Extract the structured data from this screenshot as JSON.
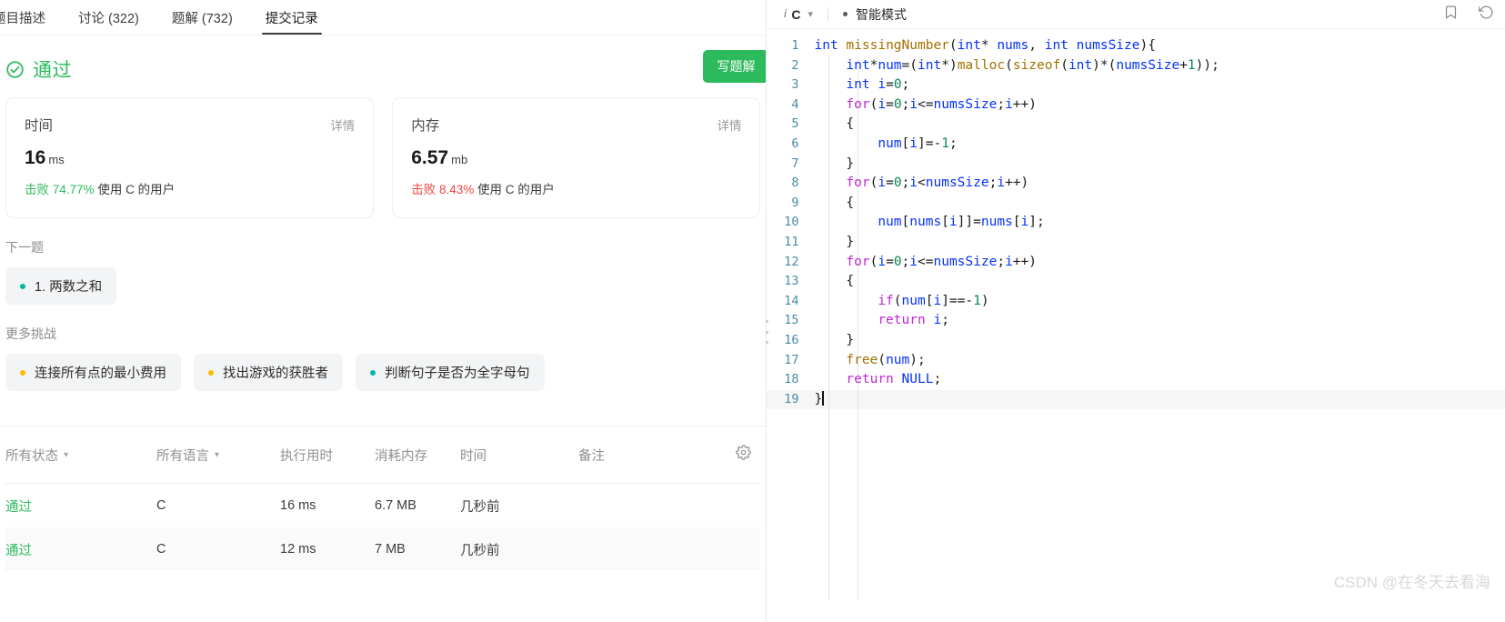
{
  "tabs": [
    {
      "label": "题目描述",
      "active": false
    },
    {
      "label": "讨论 (322)",
      "active": false
    },
    {
      "label": "题解 (732)",
      "active": false
    },
    {
      "label": "提交记录",
      "active": true
    }
  ],
  "result": {
    "status_text": "通过",
    "status_color": "#2cbb5d",
    "write_solution_label": "写题解"
  },
  "cards": [
    {
      "title": "时间",
      "detail_label": "详情",
      "value": "16",
      "unit": "ms",
      "beat_prefix": "击败",
      "beat_pct": "74.77%",
      "beat_suffix": "使用 C 的用户",
      "pct_tone": "good"
    },
    {
      "title": "内存",
      "detail_label": "详情",
      "value": "6.57",
      "unit": "mb",
      "beat_prefix": "击败",
      "beat_pct": "8.43%",
      "beat_suffix": "使用 C 的用户",
      "pct_tone": "bad"
    }
  ],
  "next_problem": {
    "label": "下一题",
    "chips": [
      {
        "text": "1. 两数之和",
        "difficulty": "easy"
      }
    ]
  },
  "more_challenges": {
    "label": "更多挑战",
    "chips": [
      {
        "text": "连接所有点的最小费用",
        "difficulty": "medium"
      },
      {
        "text": "找出游戏的获胜者",
        "difficulty": "medium"
      },
      {
        "text": "判断句子是否为全字母句",
        "difficulty": "easy"
      }
    ]
  },
  "submissions_table": {
    "headers": [
      {
        "label": "所有状态",
        "has_caret": true
      },
      {
        "label": "所有语言",
        "has_caret": true
      },
      {
        "label": "执行用时",
        "has_caret": false
      },
      {
        "label": "消耗内存",
        "has_caret": false
      },
      {
        "label": "时间",
        "has_caret": false
      },
      {
        "label": "备注",
        "has_caret": false
      }
    ],
    "settings_icon": "gear-icon",
    "rows": [
      {
        "status": "通过",
        "language": "C",
        "runtime": "16 ms",
        "memory": "6.7 MB",
        "time": "几秒前",
        "note": ""
      },
      {
        "status": "通过",
        "language": "C",
        "runtime": "12 ms",
        "memory": "7 MB",
        "time": "几秒前",
        "note": ""
      }
    ]
  },
  "editor": {
    "language": "C",
    "info_icon": "info-icon",
    "chevron_icon": "chevron-down-icon",
    "smart_mode_label": "智能模式",
    "bookmark_icon": "bookmark-icon",
    "reset_icon": "reset-icon",
    "cursor_line": 19,
    "lines": [
      {
        "n": 1,
        "tokens": [
          {
            "t": "int",
            "c": "kw"
          },
          {
            "t": " ",
            "c": "plain"
          },
          {
            "t": "missingNumber",
            "c": "fn"
          },
          {
            "t": "(",
            "c": "plain"
          },
          {
            "t": "int",
            "c": "kw"
          },
          {
            "t": "* ",
            "c": "plain"
          },
          {
            "t": "nums",
            "c": "var"
          },
          {
            "t": ", ",
            "c": "plain"
          },
          {
            "t": "int",
            "c": "kw"
          },
          {
            "t": " ",
            "c": "plain"
          },
          {
            "t": "numsSize",
            "c": "var"
          },
          {
            "t": "){",
            "c": "plain"
          }
        ]
      },
      {
        "n": 2,
        "tokens": [
          {
            "t": "    ",
            "c": "plain"
          },
          {
            "t": "int",
            "c": "kw"
          },
          {
            "t": "*",
            "c": "plain"
          },
          {
            "t": "num",
            "c": "var"
          },
          {
            "t": "=(",
            "c": "plain"
          },
          {
            "t": "int",
            "c": "kw"
          },
          {
            "t": "*)",
            "c": "plain"
          },
          {
            "t": "malloc",
            "c": "fn"
          },
          {
            "t": "(",
            "c": "plain"
          },
          {
            "t": "sizeof",
            "c": "fn"
          },
          {
            "t": "(",
            "c": "plain"
          },
          {
            "t": "int",
            "c": "kw"
          },
          {
            "t": ")*(",
            "c": "plain"
          },
          {
            "t": "numsSize",
            "c": "var"
          },
          {
            "t": "+",
            "c": "plain"
          },
          {
            "t": "1",
            "c": "num"
          },
          {
            "t": "));",
            "c": "plain"
          }
        ]
      },
      {
        "n": 3,
        "tokens": [
          {
            "t": "    ",
            "c": "plain"
          },
          {
            "t": "int",
            "c": "kw"
          },
          {
            "t": " ",
            "c": "plain"
          },
          {
            "t": "i",
            "c": "var"
          },
          {
            "t": "=",
            "c": "plain"
          },
          {
            "t": "0",
            "c": "num"
          },
          {
            "t": ";",
            "c": "plain"
          }
        ]
      },
      {
        "n": 4,
        "tokens": [
          {
            "t": "    ",
            "c": "plain"
          },
          {
            "t": "for",
            "c": "ctrl"
          },
          {
            "t": "(",
            "c": "plain"
          },
          {
            "t": "i",
            "c": "var"
          },
          {
            "t": "=",
            "c": "plain"
          },
          {
            "t": "0",
            "c": "num"
          },
          {
            "t": ";",
            "c": "plain"
          },
          {
            "t": "i",
            "c": "var"
          },
          {
            "t": "<=",
            "c": "plain"
          },
          {
            "t": "numsSize",
            "c": "var"
          },
          {
            "t": ";",
            "c": "plain"
          },
          {
            "t": "i",
            "c": "var"
          },
          {
            "t": "++)",
            "c": "plain"
          }
        ]
      },
      {
        "n": 5,
        "tokens": [
          {
            "t": "    {",
            "c": "plain"
          }
        ]
      },
      {
        "n": 6,
        "tokens": [
          {
            "t": "        ",
            "c": "plain"
          },
          {
            "t": "num",
            "c": "var"
          },
          {
            "t": "[",
            "c": "plain"
          },
          {
            "t": "i",
            "c": "var"
          },
          {
            "t": "]=-",
            "c": "plain"
          },
          {
            "t": "1",
            "c": "num"
          },
          {
            "t": ";",
            "c": "plain"
          }
        ]
      },
      {
        "n": 7,
        "tokens": [
          {
            "t": "    }",
            "c": "plain"
          }
        ]
      },
      {
        "n": 8,
        "tokens": [
          {
            "t": "    ",
            "c": "plain"
          },
          {
            "t": "for",
            "c": "ctrl"
          },
          {
            "t": "(",
            "c": "plain"
          },
          {
            "t": "i",
            "c": "var"
          },
          {
            "t": "=",
            "c": "plain"
          },
          {
            "t": "0",
            "c": "num"
          },
          {
            "t": ";",
            "c": "plain"
          },
          {
            "t": "i",
            "c": "var"
          },
          {
            "t": "<",
            "c": "plain"
          },
          {
            "t": "numsSize",
            "c": "var"
          },
          {
            "t": ";",
            "c": "plain"
          },
          {
            "t": "i",
            "c": "var"
          },
          {
            "t": "++)",
            "c": "plain"
          }
        ]
      },
      {
        "n": 9,
        "tokens": [
          {
            "t": "    {",
            "c": "plain"
          }
        ]
      },
      {
        "n": 10,
        "tokens": [
          {
            "t": "        ",
            "c": "plain"
          },
          {
            "t": "num",
            "c": "var"
          },
          {
            "t": "[",
            "c": "plain"
          },
          {
            "t": "nums",
            "c": "var"
          },
          {
            "t": "[",
            "c": "plain"
          },
          {
            "t": "i",
            "c": "var"
          },
          {
            "t": "]]=",
            "c": "plain"
          },
          {
            "t": "nums",
            "c": "var"
          },
          {
            "t": "[",
            "c": "plain"
          },
          {
            "t": "i",
            "c": "var"
          },
          {
            "t": "];",
            "c": "plain"
          }
        ]
      },
      {
        "n": 11,
        "tokens": [
          {
            "t": "    }",
            "c": "plain"
          }
        ]
      },
      {
        "n": 12,
        "tokens": [
          {
            "t": "    ",
            "c": "plain"
          },
          {
            "t": "for",
            "c": "ctrl"
          },
          {
            "t": "(",
            "c": "plain"
          },
          {
            "t": "i",
            "c": "var"
          },
          {
            "t": "=",
            "c": "plain"
          },
          {
            "t": "0",
            "c": "num"
          },
          {
            "t": ";",
            "c": "plain"
          },
          {
            "t": "i",
            "c": "var"
          },
          {
            "t": "<=",
            "c": "plain"
          },
          {
            "t": "numsSize",
            "c": "var"
          },
          {
            "t": ";",
            "c": "plain"
          },
          {
            "t": "i",
            "c": "var"
          },
          {
            "t": "++)",
            "c": "plain"
          }
        ]
      },
      {
        "n": 13,
        "tokens": [
          {
            "t": "    {",
            "c": "plain"
          }
        ]
      },
      {
        "n": 14,
        "tokens": [
          {
            "t": "        ",
            "c": "plain"
          },
          {
            "t": "if",
            "c": "ctrl"
          },
          {
            "t": "(",
            "c": "plain"
          },
          {
            "t": "num",
            "c": "var"
          },
          {
            "t": "[",
            "c": "plain"
          },
          {
            "t": "i",
            "c": "var"
          },
          {
            "t": "]==-",
            "c": "plain"
          },
          {
            "t": "1",
            "c": "num"
          },
          {
            "t": ")",
            "c": "plain"
          }
        ]
      },
      {
        "n": 15,
        "tokens": [
          {
            "t": "        ",
            "c": "plain"
          },
          {
            "t": "return",
            "c": "ctrl"
          },
          {
            "t": " ",
            "c": "plain"
          },
          {
            "t": "i",
            "c": "var"
          },
          {
            "t": ";",
            "c": "plain"
          }
        ]
      },
      {
        "n": 16,
        "tokens": [
          {
            "t": "    }",
            "c": "plain"
          }
        ]
      },
      {
        "n": 17,
        "tokens": [
          {
            "t": "    ",
            "c": "plain"
          },
          {
            "t": "free",
            "c": "fn"
          },
          {
            "t": "(",
            "c": "plain"
          },
          {
            "t": "num",
            "c": "var"
          },
          {
            "t": ");",
            "c": "plain"
          }
        ]
      },
      {
        "n": 18,
        "tokens": [
          {
            "t": "    ",
            "c": "plain"
          },
          {
            "t": "return",
            "c": "ctrl"
          },
          {
            "t": " ",
            "c": "plain"
          },
          {
            "t": "NULL",
            "c": "var"
          },
          {
            "t": ";",
            "c": "plain"
          }
        ]
      },
      {
        "n": 19,
        "tokens": [
          {
            "t": "}",
            "c": "plain"
          }
        ]
      }
    ]
  },
  "watermark": "CSDN @在冬天去看海"
}
